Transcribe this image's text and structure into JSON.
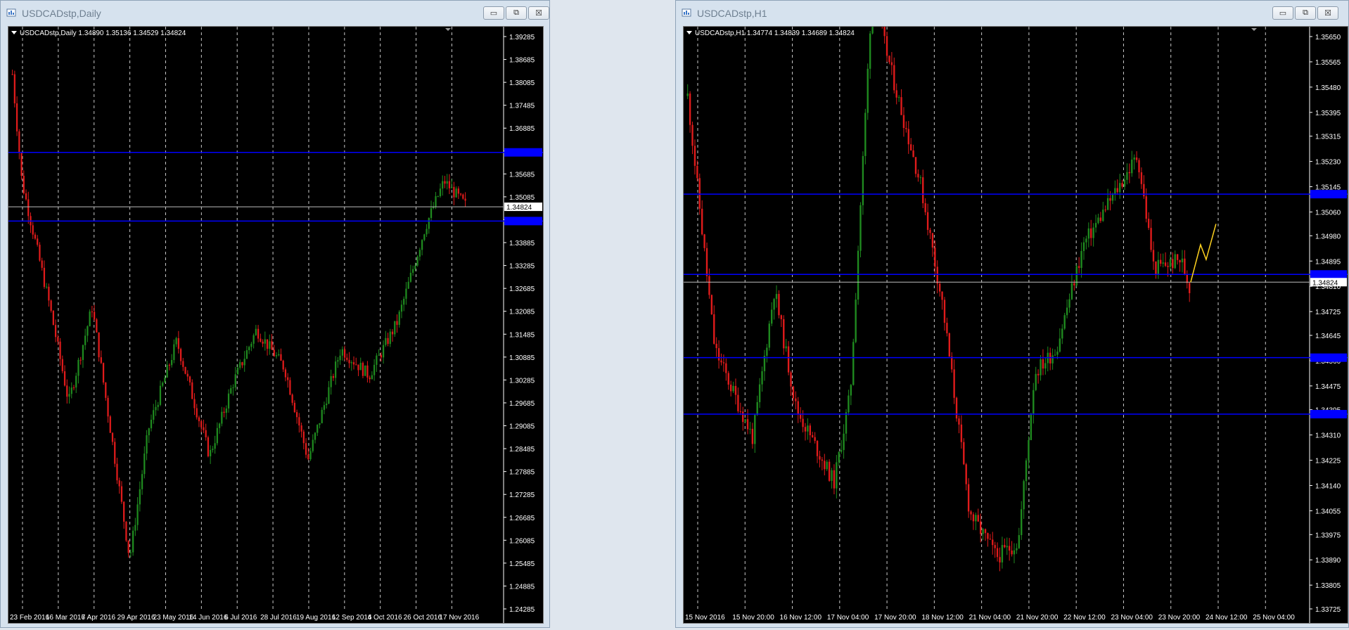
{
  "windows": [
    {
      "title": "USDCADstp,Daily",
      "header": "USDCADstp,Daily  1.34890 1.35136 1.34529 1.34824",
      "price_levels": [
        "1.39285",
        "1.38685",
        "1.38085",
        "1.37485",
        "1.36885",
        "1.36285",
        "1.35685",
        "1.35085",
        "1.34485",
        "1.33885",
        "1.33285",
        "1.32685",
        "1.32085",
        "1.31485",
        "1.30885",
        "1.30285",
        "1.29685",
        "1.29085",
        "1.28485",
        "1.27885",
        "1.27285",
        "1.26685",
        "1.26085",
        "1.25485",
        "1.24885",
        "1.24285"
      ],
      "time_labels": [
        "23 Feb 2016",
        "16 Mar 2016",
        "7 Apr 2016",
        "29 Apr 2016",
        "23 May 2016",
        "14 Jun 2016",
        "6 Jul 2016",
        "28 Jul 2016",
        "19 Aug 2016",
        "12 Sep 2016",
        "4 Oct 2016",
        "26 Oct 2016",
        "17 Nov 2016"
      ],
      "current_price": "1.34824",
      "hlines": [
        1.3625,
        1.3445
      ],
      "current": 1.34824
    },
    {
      "title": "USDCADstp,H1",
      "header": "USDCADstp,H1  1.34774 1.34839 1.34689 1.34824",
      "price_levels": [
        "1.35650",
        "1.35565",
        "1.35480",
        "1.35395",
        "1.35315",
        "1.35230",
        "1.35145",
        "1.35060",
        "1.34980",
        "1.34895",
        "1.34810",
        "1.34725",
        "1.34645",
        "1.34560",
        "1.34475",
        "1.34395",
        "1.34310",
        "1.34225",
        "1.34140",
        "1.34055",
        "1.33975",
        "1.33890",
        "1.33805",
        "1.33725"
      ],
      "time_labels": [
        "15 Nov 2016",
        "15 Nov 20:00",
        "16 Nov 12:00",
        "17 Nov 04:00",
        "17 Nov 20:00",
        "18 Nov 12:00",
        "21 Nov 04:00",
        "21 Nov 20:00",
        "22 Nov 12:00",
        "23 Nov 04:00",
        "23 Nov 20:00",
        "24 Nov 12:00",
        "25 Nov 04:00"
      ],
      "current_price": "1.34824",
      "hlines": [
        1.3512,
        1.3485,
        1.3457,
        1.3438
      ],
      "current": 1.34824
    }
  ],
  "controls": {
    "minimize": "▭",
    "restore": "⧉",
    "close": "☒"
  },
  "colors": {
    "bull": "#1f8a1f",
    "bear": "#e01b1b",
    "level": "#0000ff",
    "grid": "#c8c8c8",
    "projection": "#ffd21f"
  }
}
